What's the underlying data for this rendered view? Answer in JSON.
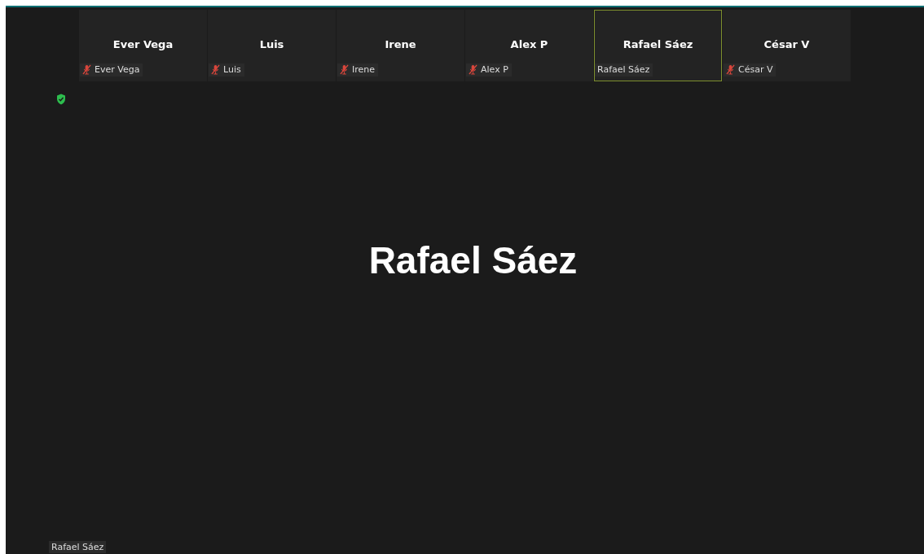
{
  "participants": [
    {
      "tile_name": "Ever Vega",
      "label": "Ever Vega",
      "muted": true,
      "selected": false
    },
    {
      "tile_name": "Luis",
      "label": "Luis",
      "muted": true,
      "selected": false
    },
    {
      "tile_name": "Irene",
      "label": "Irene",
      "muted": true,
      "selected": false
    },
    {
      "tile_name": "Alex P",
      "label": "Alex P",
      "muted": true,
      "selected": false
    },
    {
      "tile_name": "Rafael Sáez",
      "label": "Rafael Sáez",
      "muted": false,
      "selected": true
    },
    {
      "tile_name": "César V",
      "label": "César V",
      "muted": true,
      "selected": false
    }
  ],
  "main_view": {
    "speaker_name": "Rafael Sáez",
    "name_label": "Rafael Sáez"
  }
}
